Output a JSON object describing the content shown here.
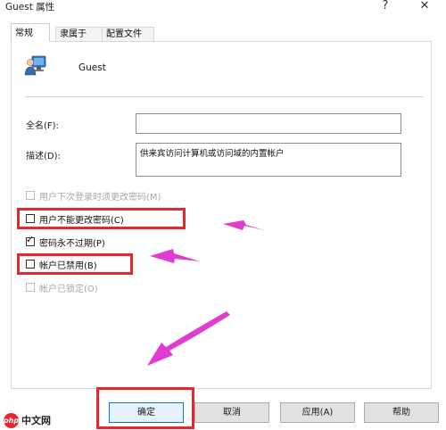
{
  "window": {
    "title": "Guest 属性",
    "help_symbol": "?",
    "close_symbol": "✕"
  },
  "tabs": [
    {
      "label": "常规",
      "active": true
    },
    {
      "label": "隶属于",
      "active": false
    },
    {
      "label": "配置文件",
      "active": false
    }
  ],
  "user": {
    "name": "Guest",
    "icon": "user-account-icon"
  },
  "fields": {
    "fullname": {
      "label": "全名(F):",
      "value": ""
    },
    "description": {
      "label": "描述(D):",
      "value": "供来宾访问计算机或访问域的内置帐户"
    }
  },
  "checkboxes": [
    {
      "label": "用户下次登录时须更改密码(M)",
      "checked": false,
      "enabled": false,
      "highlighted": false
    },
    {
      "label": "用户不能更改密码(C)",
      "checked": false,
      "enabled": true,
      "highlighted": true
    },
    {
      "label": "密码永不过期(P)",
      "checked": true,
      "enabled": true,
      "highlighted": false
    },
    {
      "label": "帐户已禁用(B)",
      "checked": false,
      "enabled": true,
      "highlighted": true
    },
    {
      "label": "帐户已锁定(O)",
      "checked": false,
      "enabled": false,
      "highlighted": false
    }
  ],
  "buttons": {
    "ok": "确定",
    "cancel": "取消",
    "apply": "应用(A)",
    "help": "帮助"
  },
  "annotation_colors": {
    "highlight_box": "#e8262c",
    "arrow": "#e23bd0"
  },
  "watermark": {
    "mark": "php",
    "text": "中文网"
  }
}
